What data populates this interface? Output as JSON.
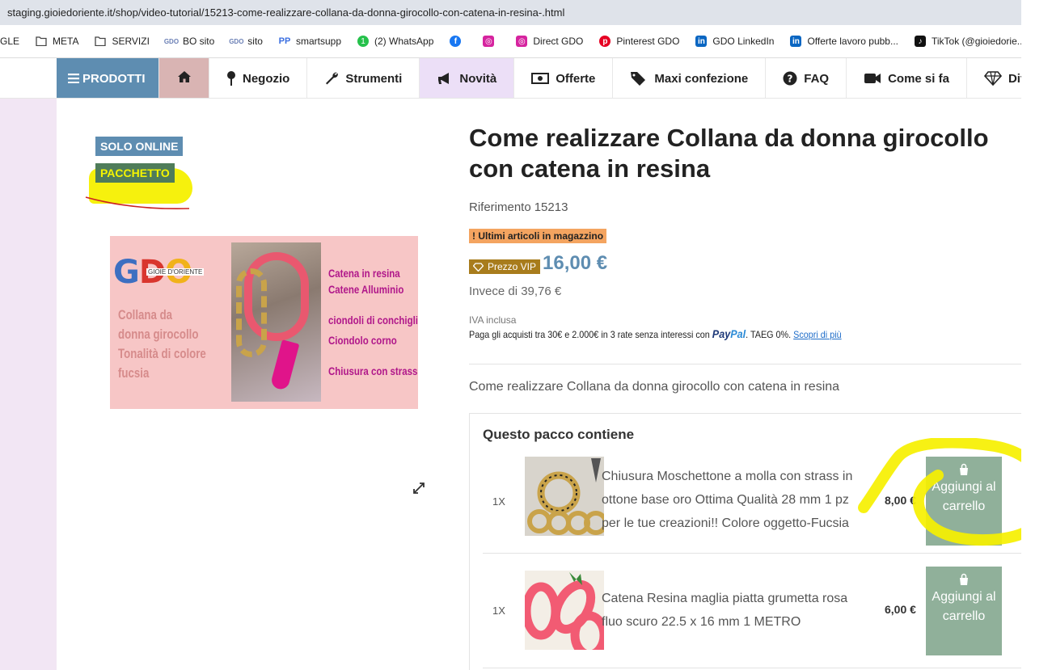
{
  "browser": {
    "url": "staging.gioiedoriente.it/shop/video-tutorial/15213-come-realizzare-collana-da-donna-girocollo-con-catena-in-resina-.html"
  },
  "bookmarks": [
    {
      "label": "GLE",
      "icon": "none"
    },
    {
      "label": "META",
      "icon": "folder-icon"
    },
    {
      "label": "SERVIZI",
      "icon": "folder-icon"
    },
    {
      "label": "BO sito",
      "icon": "gdo-icon"
    },
    {
      "label": "sito",
      "icon": "gdo-icon"
    },
    {
      "label": "smartsupp",
      "icon": "smartsupp-icon"
    },
    {
      "label": "(2) WhatsApp",
      "icon": "whatsapp-icon"
    },
    {
      "label": "",
      "icon": "facebook-icon"
    },
    {
      "label": "",
      "icon": "instagram-icon"
    },
    {
      "label": "Direct GDO",
      "icon": "instagram-icon"
    },
    {
      "label": "Pinterest GDO",
      "icon": "pinterest-icon"
    },
    {
      "label": "GDO LinkedIn",
      "icon": "linkedin-icon"
    },
    {
      "label": "Offerte lavoro pubb...",
      "icon": "linkedin-icon"
    },
    {
      "label": "TikTok (@gioiedorie...",
      "icon": "tiktok-icon"
    }
  ],
  "nav": {
    "prodotti": "PRODOTTI",
    "items": [
      {
        "label": "Negozio",
        "icon": "pin-icon"
      },
      {
        "label": "Strumenti",
        "icon": "wrench-icon"
      },
      {
        "label": "Novità",
        "icon": "megaphone-icon"
      },
      {
        "label": "Offerte",
        "icon": "money-icon"
      },
      {
        "label": "Maxi confezione",
        "icon": "tags-icon"
      },
      {
        "label": "FAQ",
        "icon": "question-icon"
      },
      {
        "label": "Come si fa",
        "icon": "video-icon"
      },
      {
        "label": "Div",
        "icon": "diamond-icon"
      }
    ]
  },
  "badges": {
    "online": "SOLO ONLINE",
    "pacchetto": "PACCHETTO"
  },
  "image": {
    "logo": "GDO",
    "logo_sub": "GIOIE D'ORIENTE",
    "left_text": "Collana da donna girocollo Tonalità di colore fucsia",
    "right_lines": [
      "Catena in resina",
      "Catene Alluminio",
      "ciondoli di conchiglie",
      "Ciondolo corno",
      "Chiusura con strass"
    ]
  },
  "product": {
    "title": "Come realizzare Collana da donna girocollo con catena in resina",
    "reference_label": "Riferimento",
    "reference": "15213",
    "stock": "! Ultimi articoli in magazzino",
    "vip_label": "Prezzo VIP",
    "price": "16,00 €",
    "old_price": "Invece di 39,76 €",
    "tax": "IVA inclusa",
    "paypal_text": "Paga gli acquisti tra 30€ e 2.000€ in 3 rate senza interessi con",
    "paypal_brand_1": "Pay",
    "paypal_brand_2": "Pal",
    "paypal_taeg": ". TAEG 0%.",
    "paypal_link": "Scopri di più",
    "short_description": "Come realizzare Collana da donna girocollo con catena in resina"
  },
  "pack": {
    "title": "Questo pacco contiene",
    "items": [
      {
        "qty": "1X",
        "name": "Chiusura Moschettone a molla con strass in ottone base oro Ottima Qualità 28 mm 1 pz per le tue creazioni!! Colore oggetto-Fucsia",
        "price": "8,00 €",
        "button": "Aggiungi al carrello"
      },
      {
        "qty": "1X",
        "name": "Catena Resina maglia piatta grumetta rosa fluo scuro 22.5 x 16 mm 1 METRO",
        "price": "6,00 €",
        "button": "Aggiungi al carrello"
      }
    ]
  }
}
